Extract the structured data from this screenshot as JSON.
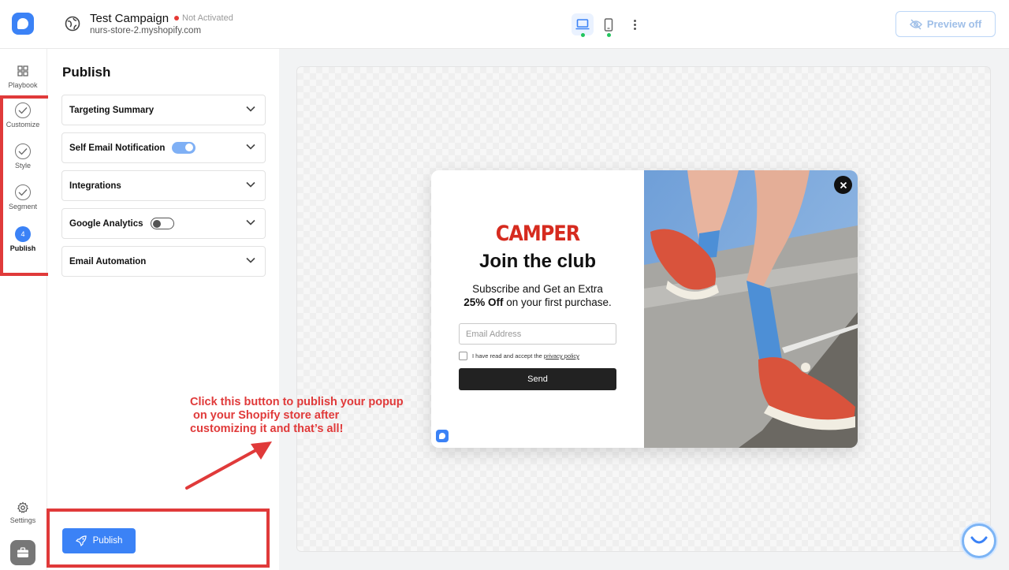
{
  "header": {
    "campaign_title": "Test Campaign",
    "status": "Not Activated",
    "store_url": "nurs-store-2.myshopify.com",
    "preview_button": "Preview off"
  },
  "rail": {
    "items": [
      {
        "label": "Playbook"
      },
      {
        "label": "Customize"
      },
      {
        "label": "Style"
      },
      {
        "label": "Segment"
      },
      {
        "label": "Publish",
        "step": "4"
      }
    ],
    "settings_label": "Settings"
  },
  "panel": {
    "title": "Publish",
    "sections": [
      {
        "label": "Targeting Summary"
      },
      {
        "label": "Self Email Notification",
        "toggle": "on"
      },
      {
        "label": "Integrations"
      },
      {
        "label": "Google Analytics",
        "toggle": "off"
      },
      {
        "label": "Email Automation"
      }
    ],
    "publish_button": "Publish"
  },
  "popup": {
    "brand": "CAMPER",
    "headline": "Join the club",
    "subtitle_line1": "Subscribe and Get an Extra",
    "subtitle_bold": "25% Off",
    "subtitle_rest": " on your first purchase.",
    "email_placeholder": "Email Address",
    "consent_text": "I have read and accept the ",
    "consent_link": "privacy policy",
    "send_button": "Send"
  },
  "annotation": {
    "line1": "Click this button to publish your popup",
    "line2": " on your Shopify store after",
    "line3": "customizing it and that’s all!"
  },
  "colors": {
    "accent": "#3b82f6",
    "annotation_red": "#e03a3a",
    "brand_red": "#d62b1f",
    "status_red": "#e53935"
  }
}
